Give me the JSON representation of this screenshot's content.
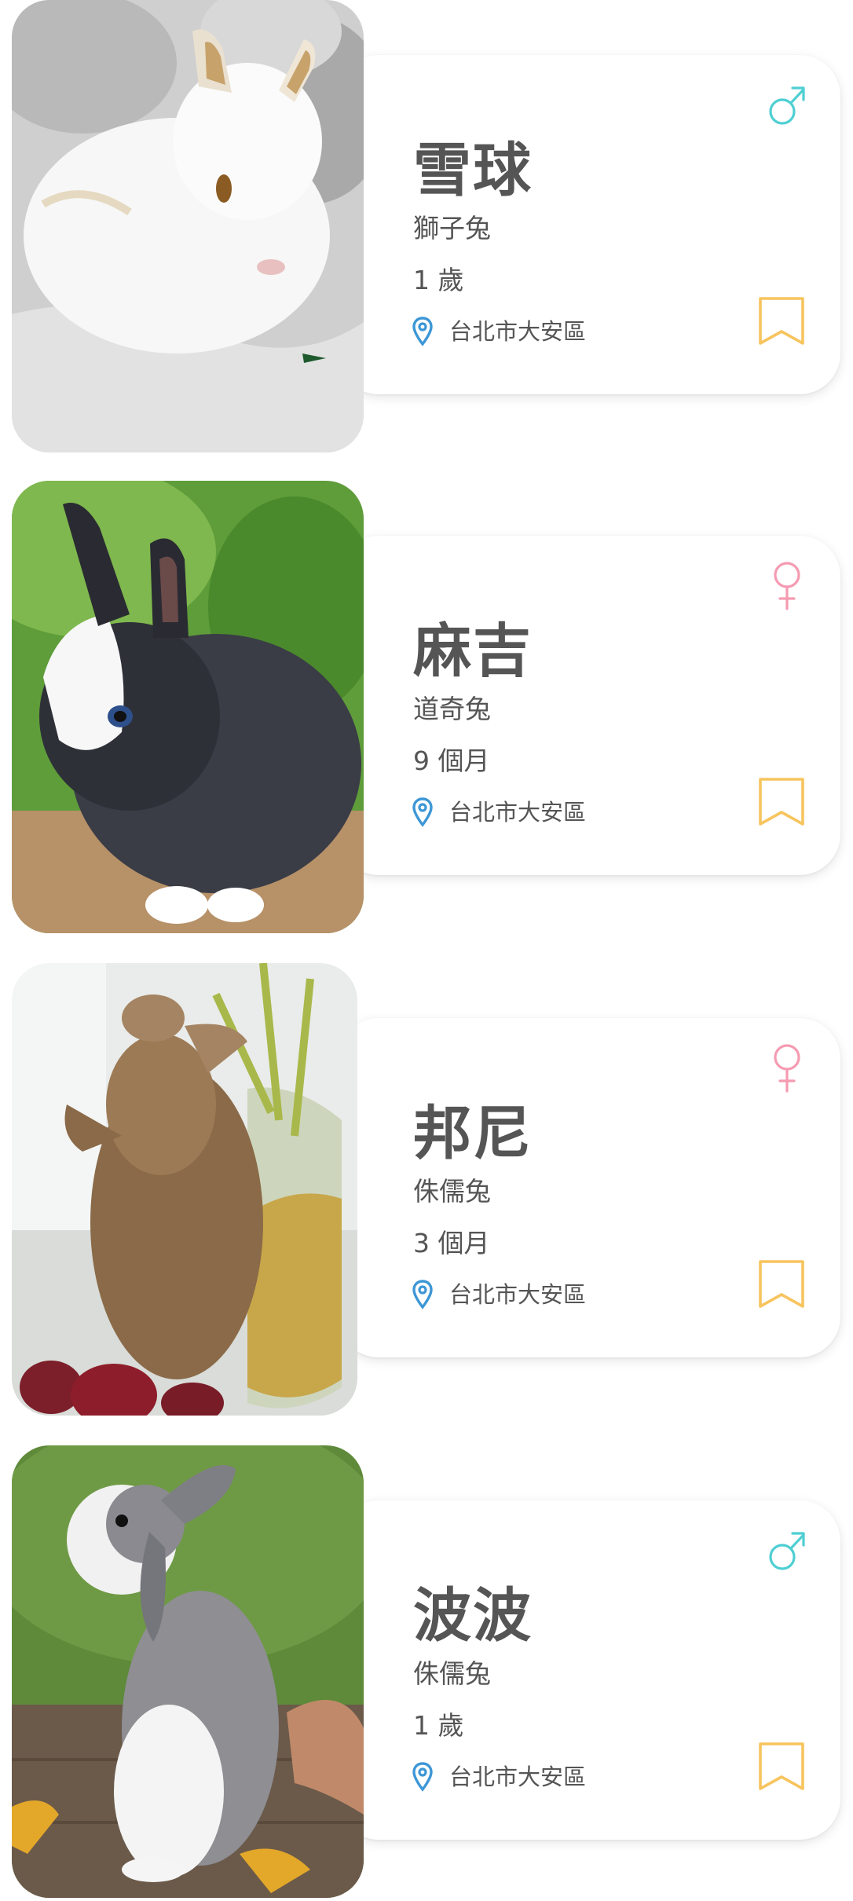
{
  "colors": {
    "male": "#4ecfd3",
    "female": "#f59bb2",
    "bookmark": "#f7c45e",
    "location_pin": "#3d97d6",
    "text": "#555555"
  },
  "pets": [
    {
      "name": "雪球",
      "breed": "獅子兔",
      "age": "1 歲",
      "location": "台北市大安區",
      "gender": "male"
    },
    {
      "name": "麻吉",
      "breed": "道奇兔",
      "age": "9 個月",
      "location": "台北市大安區",
      "gender": "female"
    },
    {
      "name": "邦尼",
      "breed": "侏儒兔",
      "age": "3 個月",
      "location": "台北市大安區",
      "gender": "female"
    },
    {
      "name": "波波",
      "breed": "侏儒兔",
      "age": "1 歲",
      "location": "台北市大安區",
      "gender": "male"
    }
  ]
}
